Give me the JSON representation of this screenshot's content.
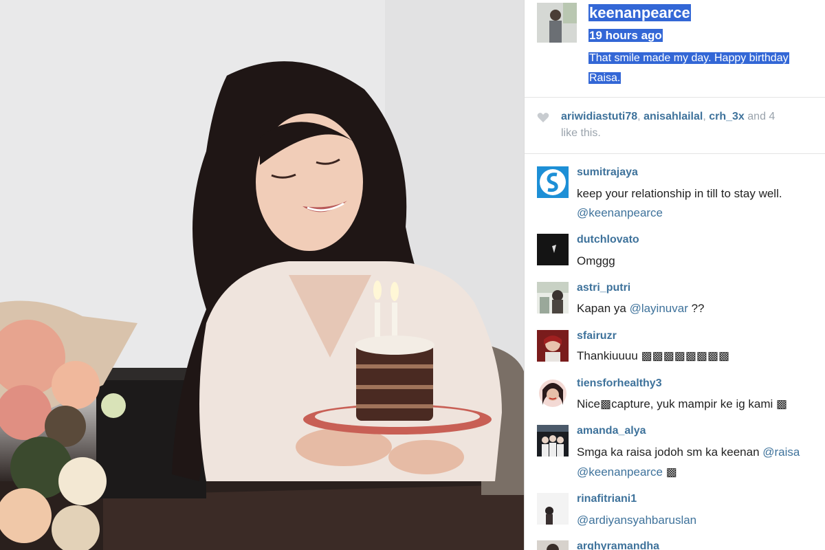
{
  "post": {
    "author": "keenanpearce",
    "time": "19 hours ago",
    "caption_lines": [
      "That smile made my day. Happy birthday",
      "Raisa."
    ]
  },
  "likes": {
    "users": [
      "ariwidiastuti78",
      "anisahlailal",
      "crh_3x"
    ],
    "sep": ",",
    "rest": "and 4",
    "line2": "like this."
  },
  "comments": [
    {
      "user": "sumitrajaya",
      "lines": [
        "keep your relationship in till to stay well.",
        ""
      ],
      "mention": "@keenanpearce"
    },
    {
      "user": "dutchlovato",
      "lines": [
        "Omggg"
      ]
    },
    {
      "user": "astri_putri",
      "text_a": "Kapan ya ",
      "mention": "@layinuvar",
      "text_b": " ??"
    },
    {
      "user": "sfairuzr",
      "text": "Thankiuuuu ▩▩▩▩▩▩▩▩"
    },
    {
      "user": "tiensforhealthy3",
      "text": "Nice▩capture, yuk mampir ke ig kami ▩"
    },
    {
      "user": "amanda_alya",
      "text_a": "Smga ka raisa jodoh sm ka keenan ",
      "mention_a": "@raisa",
      "mention_b": "@keenanpearce",
      "text_b": " ▩"
    },
    {
      "user": "rinafitriani1",
      "mention": "@ardiyansyahbaruslan"
    },
    {
      "user": "arghyramandha"
    }
  ],
  "colors": {
    "link": "#3e729b",
    "highlight": "#3367d6",
    "muted": "#9aa3ac"
  },
  "icons": [
    "heart-icon"
  ]
}
